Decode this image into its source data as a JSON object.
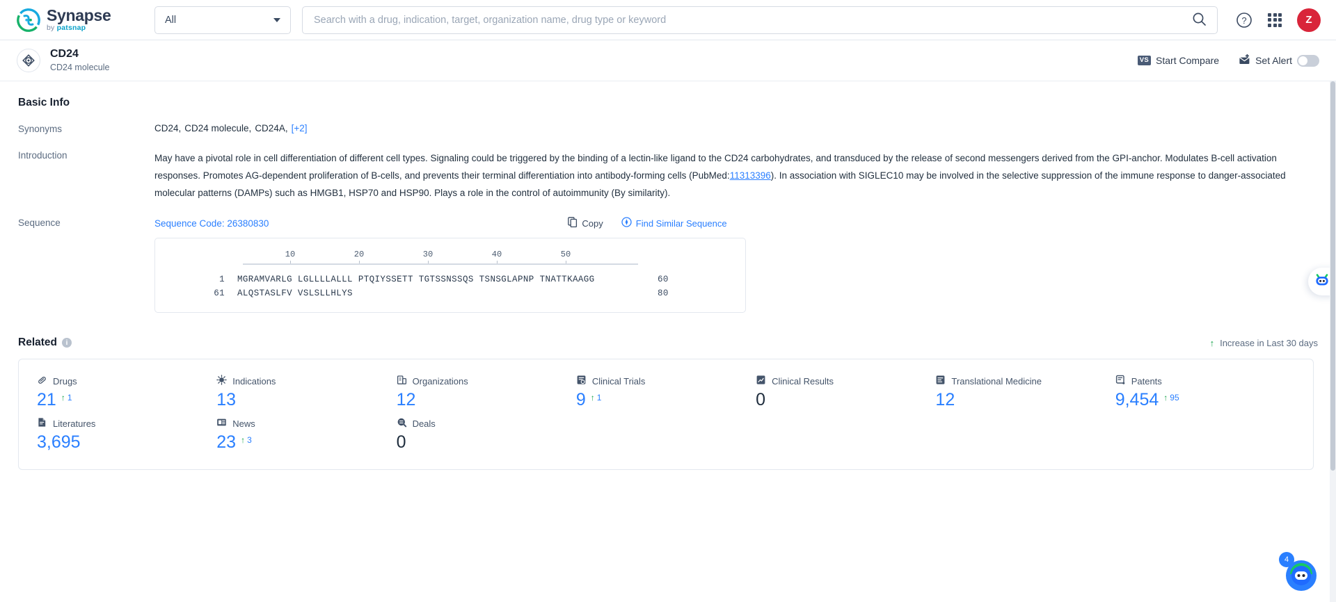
{
  "header": {
    "logo_title": "Synapse",
    "logo_sub_prefix": "by ",
    "logo_sub_brand": "patsnap",
    "scope_value": "All",
    "search_placeholder": "Search with a drug, indication, target, organization name, drug type or keyword",
    "search_value": "",
    "help_label": "?",
    "avatar_initial": "Z"
  },
  "subheader": {
    "entity_name": "CD24",
    "entity_subtitle": "CD24 molecule",
    "start_compare": "Start Compare",
    "vs_badge": "VS",
    "set_alert": "Set Alert",
    "alert_enabled": false
  },
  "basic_info": {
    "title": "Basic Info",
    "synonyms_label": "Synonyms",
    "synonyms": [
      "CD24,",
      "CD24 molecule,",
      "CD24A,"
    ],
    "synonyms_more": "[+2]",
    "introduction_label": "Introduction",
    "introduction_part1": "May have a pivotal role in cell differentiation of different cell types. Signaling could be triggered by the binding of a lectin-like ligand to the CD24 carbohydrates, and transduced by the release of second messengers derived from the GPI-anchor. Modulates B-cell activation responses. Promotes AG-dependent proliferation of B-cells, and prevents their terminal differentiation into antibody-forming cells (PubMed:",
    "pubmed_id": "11313396",
    "introduction_part2": "). In association with SIGLEC10 may be involved in the selective suppression of the immune response to danger-associated molecular patterns (DAMPs) such as HMGB1, HSP70 and HSP90. Plays a role in the control of autoimmunity (By similarity)."
  },
  "sequence": {
    "label": "Sequence",
    "code_text": "Sequence Code: 26380830",
    "copy_label": "Copy",
    "find_similar_label": "Find Similar Sequence",
    "ruler_ticks": [
      "10",
      "20",
      "30",
      "40",
      "50"
    ],
    "lines": [
      {
        "start": "1",
        "residues": "MGRAMVARLG LGLLLLALLL PTQIYSSETT TGTSSNSSQS TSNSGLAPNP TNATTKAAGG",
        "end": "60"
      },
      {
        "start": "61",
        "residues": "ALQSTASLFV VSLSLLHLYS",
        "end": "80"
      }
    ]
  },
  "related": {
    "title": "Related",
    "info_glyph": "i",
    "legend_text": "Increase in Last 30 days",
    "legend_arrow": "↑",
    "stats": [
      {
        "icon": "capsule-icon",
        "label": "Drugs",
        "value": "21",
        "delta": "1",
        "is_zero": false
      },
      {
        "icon": "virus-icon",
        "label": "Indications",
        "value": "13",
        "delta": "",
        "is_zero": false
      },
      {
        "icon": "building-icon",
        "label": "Organizations",
        "value": "12",
        "delta": "",
        "is_zero": false
      },
      {
        "icon": "clinical-trial-icon",
        "label": "Clinical Trials",
        "value": "9",
        "delta": "1",
        "is_zero": false
      },
      {
        "icon": "clinical-result-icon",
        "label": "Clinical Results",
        "value": "0",
        "delta": "",
        "is_zero": true
      },
      {
        "icon": "translational-medicine-icon",
        "label": "Translational Medicine",
        "value": "12",
        "delta": "",
        "is_zero": false
      },
      {
        "icon": "patent-icon",
        "label": "Patents",
        "value": "9,454",
        "delta": "95",
        "is_zero": false
      },
      {
        "icon": "literature-icon",
        "label": "Literatures",
        "value": "3,695",
        "delta": "",
        "is_zero": false
      },
      {
        "icon": "news-icon",
        "label": "News",
        "value": "23",
        "delta": "3",
        "is_zero": false
      },
      {
        "icon": "deals-icon",
        "label": "Deals",
        "value": "0",
        "delta": "",
        "is_zero": true
      }
    ]
  },
  "floating": {
    "chat_badge": "4"
  },
  "colors": {
    "accent_blue": "#2a7fff",
    "green": "#17a34a",
    "avatar_red": "#d9253a",
    "brand_teal": "#0aa2c9"
  }
}
